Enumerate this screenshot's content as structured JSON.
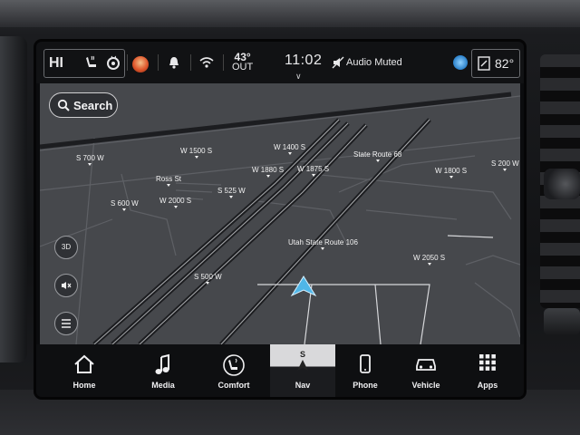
{
  "status_bar": {
    "hi_label": "HI",
    "outside_temp": "43°",
    "outside_label": "OUT",
    "clock": "11:02",
    "audio_status": "Audio Muted",
    "cabin_temp": "82°"
  },
  "map": {
    "search_label": "Search",
    "view_3d_label": "3D",
    "road_labels": {
      "w1500s": "W 1500 S",
      "w1400s": "W 1400 S",
      "s700w": "S 700 W",
      "state_route_68": "State Route 68",
      "ross_st": "Ross St",
      "w1880s": "W 1880 S",
      "w1875s": "W 1875 S",
      "w1800s": "W 1800 S",
      "s200w": "S 200 W",
      "s525w": "S 525 W",
      "s600w": "S 600 W",
      "w2000s": "W 2000 S",
      "utah_state_route_106": "Utah State Route 106",
      "w2050s": "W 2050 S",
      "s500w": "S 500 W"
    }
  },
  "nav_bar": {
    "items": [
      {
        "label": "Home",
        "icon": "home-icon"
      },
      {
        "label": "Media",
        "icon": "music-note-icon"
      },
      {
        "label": "Comfort",
        "icon": "comfort-seat-icon"
      },
      {
        "label": "Nav",
        "icon": "navigation-arrow-icon",
        "heading": "S",
        "active": true
      },
      {
        "label": "Phone",
        "icon": "phone-icon"
      },
      {
        "label": "Vehicle",
        "icon": "car-icon"
      },
      {
        "label": "Apps",
        "icon": "apps-grid-icon"
      }
    ]
  },
  "colors": {
    "map_background": "#46484c",
    "road": "#1c1d20",
    "position_arrow": "#4fb6e8",
    "active_tab": "#d9d9db"
  }
}
